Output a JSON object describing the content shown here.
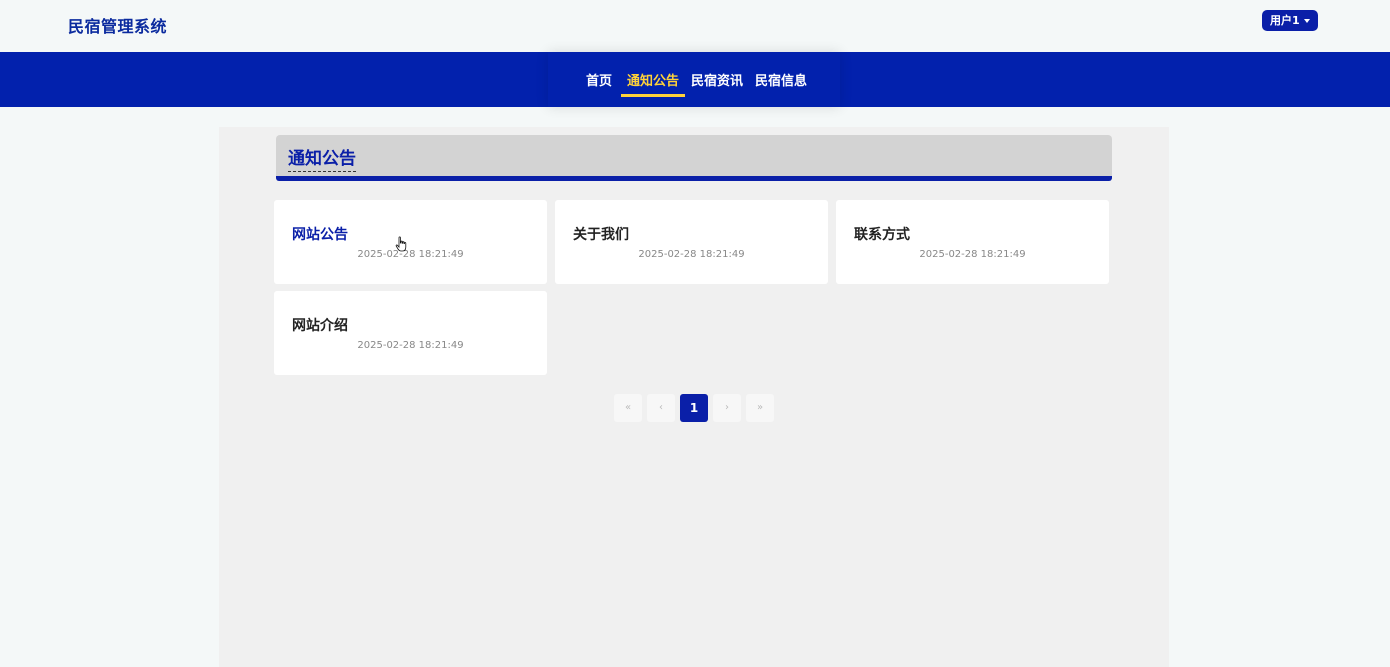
{
  "header": {
    "brand": "民宿管理系统",
    "user_label": "用户1"
  },
  "nav": {
    "items": [
      {
        "label": "首页",
        "active": false
      },
      {
        "label": "通知公告",
        "active": true
      },
      {
        "label": "民宿资讯",
        "active": false
      },
      {
        "label": "民宿信息",
        "active": false
      }
    ]
  },
  "section": {
    "title": "通知公告"
  },
  "notices": [
    {
      "title": "网站公告",
      "time": "2025-02-28 18:21:49"
    },
    {
      "title": "关于我们",
      "time": "2025-02-28 18:21:49"
    },
    {
      "title": "联系方式",
      "time": "2025-02-28 18:21:49"
    },
    {
      "title": "网站介绍",
      "time": "2025-02-28 18:21:49"
    }
  ],
  "pagination": {
    "first": "«",
    "prev": "‹",
    "current": "1",
    "next": "›",
    "last": "»"
  },
  "colors": {
    "brand": "#0a2a9e",
    "nav_bg": "#0221ad",
    "nav_active": "#ffd23a"
  }
}
